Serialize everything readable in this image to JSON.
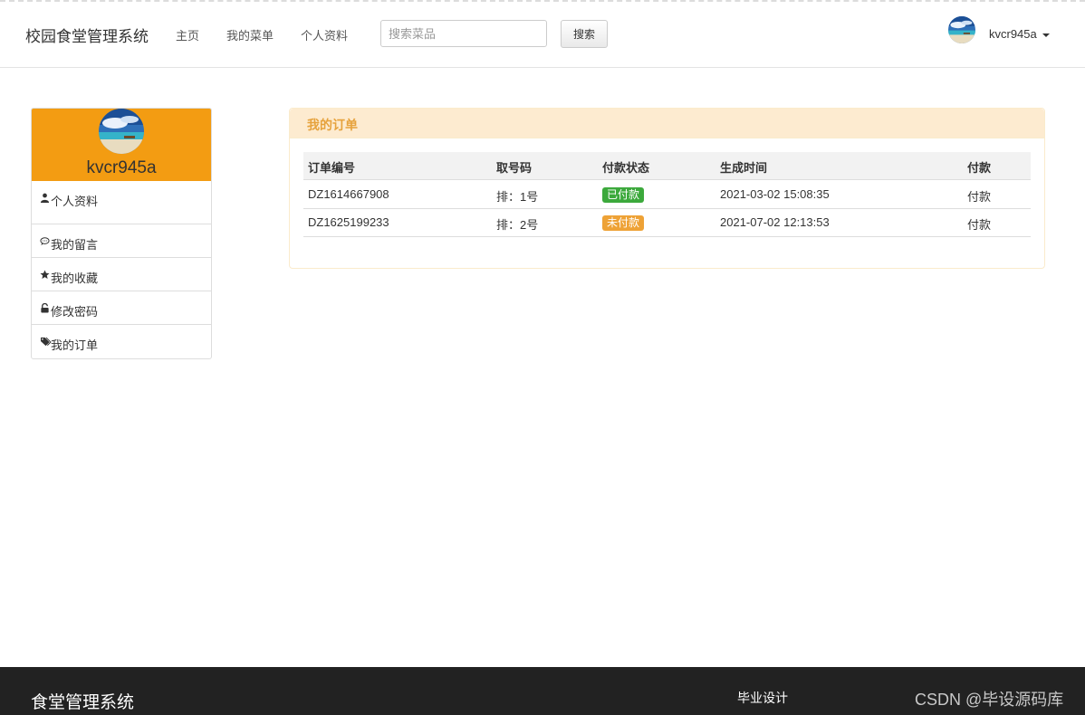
{
  "navbar": {
    "brand": "校园食堂管理系统",
    "links": [
      "主页",
      "我的菜单",
      "个人资料"
    ],
    "search_placeholder": "搜索菜品",
    "search_button": "搜索",
    "username": "kvcr945a"
  },
  "profile": {
    "username": "kvcr945a",
    "menu": [
      {
        "label": "个人资料",
        "icon": "user-icon"
      },
      {
        "label": "我的留言",
        "icon": "comment-icon"
      },
      {
        "label": "我的收藏",
        "icon": "star-icon"
      },
      {
        "label": "修改密码",
        "icon": "lock-icon"
      },
      {
        "label": "我的订单",
        "icon": "tags-icon"
      }
    ]
  },
  "orders": {
    "title": "我的订单",
    "columns": [
      "订单编号",
      "取号码",
      "付款状态",
      "生成时间",
      "付款"
    ],
    "rows": [
      {
        "order_no": "DZ1614667908",
        "ticket": "排：1号",
        "status": "已付款",
        "status_color": "#3ca93c",
        "time": "2021-03-02 15:08:35",
        "action": "付款"
      },
      {
        "order_no": "DZ1625199233",
        "ticket": "排：2号",
        "status": "未付款",
        "status_color": "#eea236",
        "time": "2021-07-02 12:13:53",
        "action": "付款"
      }
    ]
  },
  "footer": {
    "brand": "食堂管理系统",
    "link": "毕业设计",
    "watermark": "CSDN @毕设源码库"
  },
  "colors": {
    "accent": "#f39c12",
    "panel_title": "#e6a23c",
    "footer_bg": "#222222"
  }
}
